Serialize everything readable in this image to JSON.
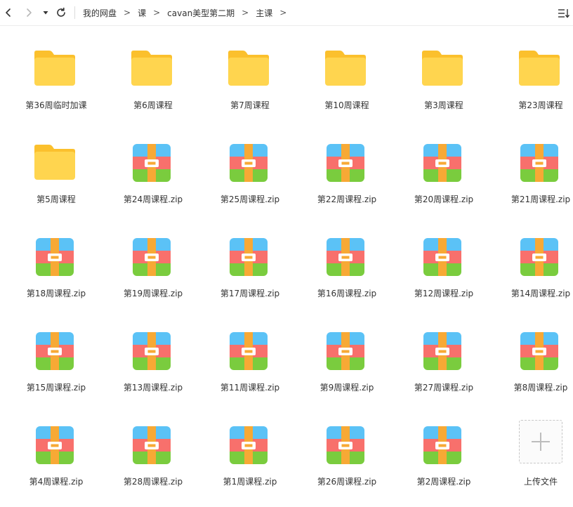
{
  "toolbar": {
    "breadcrumb": [
      "我的网盘",
      "课",
      "cavan美型第二期",
      "主课"
    ],
    "separator": ">",
    "icons": {
      "back": "chevron-left-icon",
      "forward": "chevron-right-icon",
      "history": "caret-down-icon",
      "refresh": "refresh-icon",
      "sort": "sort-list-icon"
    }
  },
  "items": [
    {
      "label": "第36周临时加课",
      "type": "folder"
    },
    {
      "label": "第6周课程",
      "type": "folder"
    },
    {
      "label": "第7周课程",
      "type": "folder"
    },
    {
      "label": "第10周课程",
      "type": "folder"
    },
    {
      "label": "第3周课程",
      "type": "folder"
    },
    {
      "label": "第23周课程",
      "type": "folder"
    },
    {
      "label": "第5周课程",
      "type": "folder"
    },
    {
      "label": "第24周课程.zip",
      "type": "zip"
    },
    {
      "label": "第25周课程.zip",
      "type": "zip"
    },
    {
      "label": "第22周课程.zip",
      "type": "zip"
    },
    {
      "label": "第20周课程.zip",
      "type": "zip"
    },
    {
      "label": "第21周课程.zip",
      "type": "zip"
    },
    {
      "label": "第18周课程.zip",
      "type": "zip"
    },
    {
      "label": "第19周课程.zip",
      "type": "zip"
    },
    {
      "label": "第17周课程.zip",
      "type": "zip"
    },
    {
      "label": "第16周课程.zip",
      "type": "zip"
    },
    {
      "label": "第12周课程.zip",
      "type": "zip"
    },
    {
      "label": "第14周课程.zip",
      "type": "zip"
    },
    {
      "label": "第15周课程.zip",
      "type": "zip"
    },
    {
      "label": "第13周课程.zip",
      "type": "zip"
    },
    {
      "label": "第11周课程.zip",
      "type": "zip"
    },
    {
      "label": "第9周课程.zip",
      "type": "zip"
    },
    {
      "label": "第27周课程.zip",
      "type": "zip"
    },
    {
      "label": "第8周课程.zip",
      "type": "zip"
    },
    {
      "label": "第4周课程.zip",
      "type": "zip"
    },
    {
      "label": "第28周课程.zip",
      "type": "zip"
    },
    {
      "label": "第1周课程.zip",
      "type": "zip"
    },
    {
      "label": "第26周课程.zip",
      "type": "zip"
    },
    {
      "label": "第2周课程.zip",
      "type": "zip"
    },
    {
      "label": "上传文件",
      "type": "upload"
    }
  ],
  "colors": {
    "folder": "#FFD54F",
    "folder_tab": "#FBC02D",
    "zip_top": "#5BC2F6",
    "zip_middle": "#F8706C",
    "zip_bottom": "#7ACC3E",
    "zip_strap": "#F7A935"
  }
}
